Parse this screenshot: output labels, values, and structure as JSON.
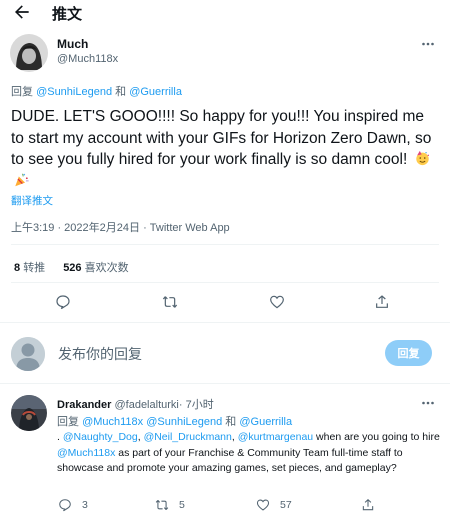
{
  "header": {
    "title": "推文"
  },
  "tweet": {
    "author_name": "Much",
    "author_handle": "@Much118x",
    "reply_prefix": "回复 ",
    "reply_user1": "@SunhiLegend",
    "reply_and": " 和 ",
    "reply_user2": "@Guerrilla",
    "text": "DUDE. LET'S GOOO!!!! So happy for you!!! You inspired me to start my account with your GIFs for Horizon Zero Dawn, so to see you fully hired for your work finally is so damn cool! ",
    "translate_label": "翻译推文",
    "meta": "上午3:19 · 2022年2月24日 · Twitter Web App",
    "retweet_count": "8",
    "retweet_label": "转推",
    "quote_count": "526",
    "quote_label": "喜欢次数"
  },
  "composer": {
    "placeholder": "发布你的回复",
    "reply_button": "回复"
  },
  "reply": {
    "author_name": "Drakander",
    "author_handle": "@fadelalturki",
    "time": "· 7小时",
    "reply_prefix": "回复 ",
    "reply_user1": "@Much118x",
    "reply_user2": "@SunhiLegend",
    "reply_and": " 和 ",
    "reply_user3": "@Guerrilla",
    "text_lead": ". ",
    "mention1": "@Naughty_Dog",
    "sep1": ", ",
    "mention2": "@Neil_Druckmann",
    "sep2": ", ",
    "mention3": "@kurtmargenau",
    "text_mid": " when are you going to hire ",
    "mention4": "@Much118x",
    "text_end": " as part of your Franchise & Community Team full-time staff to showcase and promote your amazing games, set pieces, and gameplay?",
    "reply_count": "3",
    "retweet_count": "5",
    "like_count": "57"
  },
  "colors": {
    "link": "#1d9bf0",
    "secondary_text": "#536471",
    "reply_button_bg": "#8ecdf8"
  },
  "icons": [
    "back-arrow-icon",
    "more-icon",
    "reply-icon",
    "retweet-icon",
    "like-icon",
    "share-icon"
  ]
}
